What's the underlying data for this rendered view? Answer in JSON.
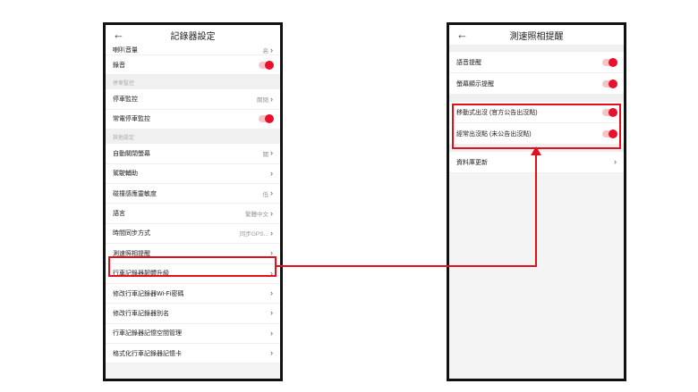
{
  "left_phone": {
    "title": "記錄器設定",
    "back_glyph": "←",
    "top_partial": {
      "label": "喇叭音量",
      "value": "高"
    },
    "recording": {
      "label": "錄音"
    },
    "sections": {
      "parking": "停車監控",
      "other": "其他設定"
    },
    "parking_monitor": {
      "label": "停車監控",
      "value": "關閉"
    },
    "constant_power": {
      "label": "常電停車監控"
    },
    "items": [
      {
        "label": "自動關閉螢幕",
        "value": "關"
      },
      {
        "label": "駕駛輔助",
        "value": ""
      },
      {
        "label": "碰撞感應靈敏度",
        "value": "低"
      },
      {
        "label": "語言",
        "value": "繁體中文"
      },
      {
        "label": "時間同步方式",
        "value": "同步GPS..."
      },
      {
        "label": "測速照相提醒",
        "value": ""
      },
      {
        "label": "行車記錄器韌體升級",
        "value": ""
      },
      {
        "label": "修改行車記錄器Wi-Fi密碼",
        "value": ""
      },
      {
        "label": "修改行車記錄器別名",
        "value": ""
      },
      {
        "label": "行車記錄器記憶空間管理",
        "value": ""
      },
      {
        "label": "格式化行車記錄器記憶卡",
        "value": ""
      }
    ],
    "chevron_glyph": "›"
  },
  "right_phone": {
    "title": "測速照相提醒",
    "back_glyph": "←",
    "toggles": [
      {
        "label": "語音提醒"
      },
      {
        "label": "螢幕顯示提醒"
      },
      {
        "label": "移動式出沒 (官方公告出沒點)"
      },
      {
        "label": "經常出沒點 (未公告出沒點)"
      }
    ],
    "database_update": {
      "label": "資料庫更新"
    },
    "chevron_glyph": "›"
  },
  "colors": {
    "accent": "#e8102a",
    "highlight": "#e3101c",
    "toggle_track": "#f2c6c6"
  }
}
